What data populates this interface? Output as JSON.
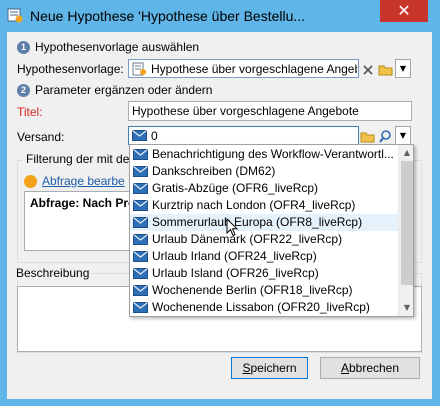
{
  "window": {
    "title": "Neue Hypothese 'Hypothese über Bestellu...",
    "close_glyph": "✕"
  },
  "step1": {
    "number": "1",
    "label": "Hypothesenvorlage auswählen"
  },
  "template": {
    "label": "Hypothesenvorlage:",
    "value": "Hypothese über vorgeschlagene Angebote"
  },
  "step2": {
    "number": "2",
    "label": "Parameter ergänzen oder ändern"
  },
  "title_field": {
    "label": "Titel:",
    "value": "Hypothese über vorgeschlagene Angebote"
  },
  "versand": {
    "label": "Versand:",
    "value": "0"
  },
  "filter_group": {
    "title": "Filterung der mit de",
    "link": "Abfrage bearbe",
    "query": "Abfrage: Nach Pro"
  },
  "description": {
    "label": "Beschreibung"
  },
  "dropdown_items": [
    "Benachrichtigung des Workflow-Verantwortl...",
    "Dankschreiben (DM62)",
    "Gratis-Abzüge (OFR6_liveRcp)",
    "Kurztrip nach London (OFR4_liveRcp)",
    "Sommerurlaub Europa (OFR8_liveRcp)",
    "Urlaub Dänemark (OFR22_liveRcp)",
    "Urlaub Irland (OFR24_liveRcp)",
    "Urlaub Island (OFR26_liveRcp)",
    "Wochenende Berlin (OFR18_liveRcp)",
    "Wochenende Lissabon (OFR20_liveRcp)"
  ],
  "buttons": {
    "save_mnemonic": "S",
    "save_rest": "peichern",
    "cancel_mnemonic": "A",
    "cancel_rest": "bbrechen"
  },
  "icons": {
    "envelope": "envelope-icon",
    "folder": "folder-icon",
    "search": "search-icon",
    "clear": "clear-icon"
  },
  "colors": {
    "titlebar": "#5fb4e8",
    "close": "#c7352b",
    "required_label": "#d8251c",
    "link": "#1f5ea8",
    "hover_row": "#e5f1fb"
  }
}
